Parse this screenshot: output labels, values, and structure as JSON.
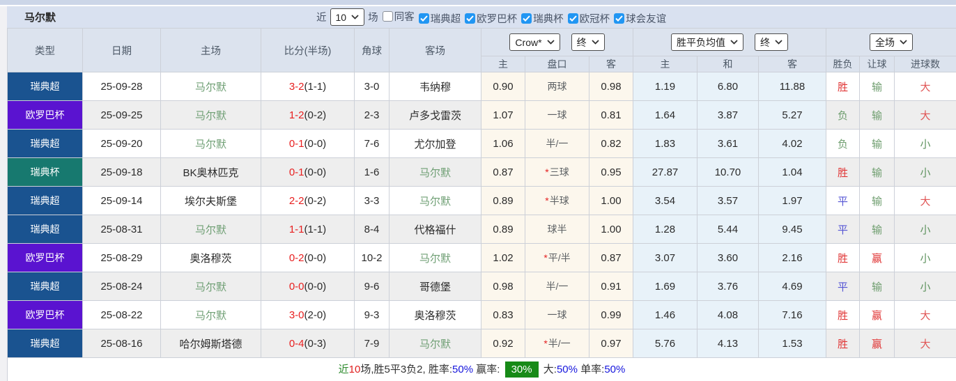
{
  "page": {
    "team_title": "马尔默"
  },
  "colors": {
    "checkbox_accent": "#2196f3",
    "score_red": "#e81f1f",
    "team_green": "#6f9f74",
    "badge_green": "#178a17",
    "percent_blue": "#1515dd"
  },
  "toolbar": {
    "recent_label": "近",
    "recent_value": "10",
    "games_label": "场",
    "filters": [
      {
        "label": "同客",
        "checked": false
      },
      {
        "label": "瑞典超",
        "checked": true
      },
      {
        "label": "欧罗巴杯",
        "checked": true
      },
      {
        "label": "瑞典杯",
        "checked": true
      },
      {
        "label": "欧冠杯",
        "checked": true
      },
      {
        "label": "球会友谊",
        "checked": true
      }
    ]
  },
  "header": {
    "columns": [
      "类型",
      "日期",
      "主场",
      "比分(半场)",
      "角球",
      "客场"
    ],
    "odds_company_select": "Crow*",
    "odds_time_select_1": "终",
    "avg_select": "胜平负均值",
    "odds_time_select_2": "终",
    "scope_select": "全场",
    "sub_columns": [
      "主",
      "盘口",
      "客",
      "主",
      "和",
      "客",
      "胜负",
      "让球",
      "进球数"
    ]
  },
  "league_colors": {
    "瑞典超": "#1a5390",
    "欧罗巴杯": "#5a13d0",
    "瑞典杯": "#17796f"
  },
  "result_colors": {
    "胜": "#e03636",
    "平": "#5555d4",
    "负": "#6f9e6f",
    "赢": "#e03636",
    "输": "#6f9e6f",
    "大": "#e05555",
    "小": "#5f935f"
  },
  "rows": [
    {
      "league": "瑞典超",
      "date": "25-09-28",
      "home": "马尔默",
      "score": "3-2",
      "half": "(1-1)",
      "corner": "3-0",
      "away": "韦纳穆",
      "o1": "0.90",
      "star": false,
      "handicap": "两球",
      "o2": "0.98",
      "m1": "1.19",
      "m2": "6.80",
      "m3": "11.88",
      "r1": "胜",
      "r2": "输",
      "r3": "大"
    },
    {
      "league": "欧罗巴杯",
      "date": "25-09-25",
      "home": "马尔默",
      "score": "1-2",
      "half": "(0-2)",
      "corner": "2-3",
      "away": "卢多戈雷茨",
      "o1": "1.07",
      "star": false,
      "handicap": "一球",
      "o2": "0.81",
      "m1": "1.64",
      "m2": "3.87",
      "m3": "5.27",
      "r1": "负",
      "r2": "输",
      "r3": "大"
    },
    {
      "league": "瑞典超",
      "date": "25-09-20",
      "home": "马尔默",
      "score": "0-1",
      "half": "(0-0)",
      "corner": "7-6",
      "away": "尤尔加登",
      "o1": "1.06",
      "star": false,
      "handicap": "半/一",
      "o2": "0.82",
      "m1": "1.83",
      "m2": "3.61",
      "m3": "4.02",
      "r1": "负",
      "r2": "输",
      "r3": "小"
    },
    {
      "league": "瑞典杯",
      "date": "25-09-18",
      "home": "BK奥林匹克",
      "score": "0-1",
      "half": "(0-0)",
      "corner": "1-6",
      "away": "马尔默",
      "o1": "0.87",
      "star": true,
      "handicap": "三球",
      "o2": "0.95",
      "m1": "27.87",
      "m2": "10.70",
      "m3": "1.04",
      "r1": "胜",
      "r2": "输",
      "r3": "小"
    },
    {
      "league": "瑞典超",
      "date": "25-09-14",
      "home": "埃尔夫斯堡",
      "score": "2-2",
      "half": "(0-2)",
      "corner": "3-3",
      "away": "马尔默",
      "o1": "0.89",
      "star": true,
      "handicap": "半球",
      "o2": "1.00",
      "m1": "3.54",
      "m2": "3.57",
      "m3": "1.97",
      "r1": "平",
      "r2": "输",
      "r3": "大"
    },
    {
      "league": "瑞典超",
      "date": "25-08-31",
      "home": "马尔默",
      "score": "1-1",
      "half": "(1-1)",
      "corner": "8-4",
      "away": "代格福什",
      "o1": "0.89",
      "star": false,
      "handicap": "球半",
      "o2": "1.00",
      "m1": "1.28",
      "m2": "5.44",
      "m3": "9.45",
      "r1": "平",
      "r2": "输",
      "r3": "小"
    },
    {
      "league": "欧罗巴杯",
      "date": "25-08-29",
      "home": "奥洛穆茨",
      "score": "0-2",
      "half": "(0-0)",
      "corner": "10-2",
      "away": "马尔默",
      "o1": "1.02",
      "star": true,
      "handicap": "平/半",
      "o2": "0.87",
      "m1": "3.07",
      "m2": "3.60",
      "m3": "2.16",
      "r1": "胜",
      "r2": "赢",
      "r3": "小"
    },
    {
      "league": "瑞典超",
      "date": "25-08-24",
      "home": "马尔默",
      "score": "0-0",
      "half": "(0-0)",
      "corner": "9-6",
      "away": "哥德堡",
      "o1": "0.98",
      "star": false,
      "handicap": "半/一",
      "o2": "0.91",
      "m1": "1.69",
      "m2": "3.76",
      "m3": "4.69",
      "r1": "平",
      "r2": "输",
      "r3": "小"
    },
    {
      "league": "欧罗巴杯",
      "date": "25-08-22",
      "home": "马尔默",
      "score": "3-0",
      "half": "(2-0)",
      "corner": "9-3",
      "away": "奥洛穆茨",
      "o1": "0.83",
      "star": false,
      "handicap": "一球",
      "o2": "0.99",
      "m1": "1.46",
      "m2": "4.08",
      "m3": "7.16",
      "r1": "胜",
      "r2": "赢",
      "r3": "大"
    },
    {
      "league": "瑞典超",
      "date": "25-08-16",
      "home": "哈尔姆斯塔德",
      "score": "0-4",
      "half": "(0-3)",
      "corner": "7-9",
      "away": "马尔默",
      "o1": "0.92",
      "star": true,
      "handicap": "半/一",
      "o2": "0.97",
      "m1": "5.76",
      "m2": "4.13",
      "m3": "1.53",
      "r1": "胜",
      "r2": "赢",
      "r3": "大"
    }
  ],
  "summary": {
    "segments": [
      {
        "text": "近",
        "color": "#2e8b2e"
      },
      {
        "text": "10",
        "color": "#e02020"
      },
      {
        "text": "场,胜5平3负2, ",
        "color": "#333333"
      },
      {
        "text": "胜率:",
        "color": "#333333"
      },
      {
        "text": "50%",
        "color": "#1515dd"
      },
      {
        "text": " 赢率: ",
        "color": "#333333"
      },
      {
        "text": "30%",
        "badge": true
      },
      {
        "text": " 大:",
        "color": "#333333"
      },
      {
        "text": "50%",
        "color": "#1515dd"
      },
      {
        "text": " 单率:",
        "color": "#333333"
      },
      {
        "text": "50%",
        "color": "#1515dd"
      }
    ]
  }
}
